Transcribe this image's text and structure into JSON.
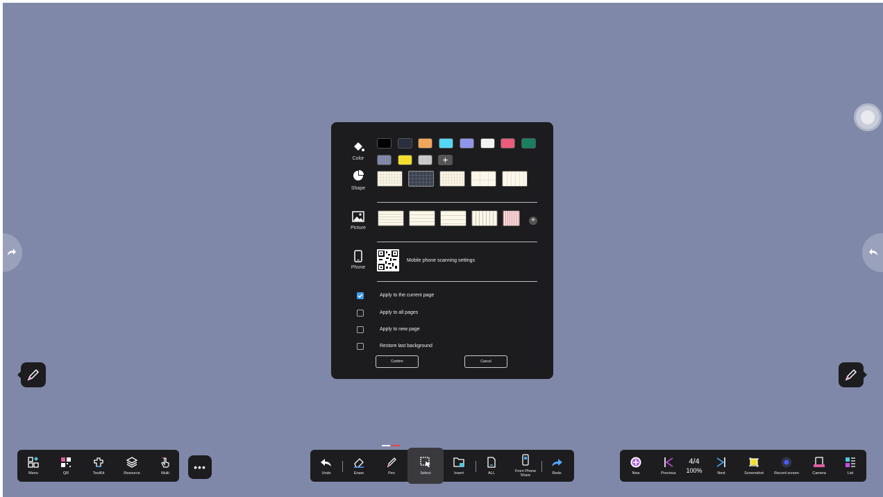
{
  "dialog": {
    "sections": {
      "color": "Color",
      "shape": "Shape",
      "picture": "Picture",
      "phone": "Phone"
    },
    "colors": [
      "#000000",
      "#2a2f3f",
      "#f2a65a",
      "#55d6f5",
      "#8f96e8",
      "#f3f3f3",
      "#ea5c7a",
      "#18805e",
      "#7f88a8",
      "#f5de2b",
      "#c8c8c8"
    ],
    "add_color_icon": "plus-icon",
    "phone_text": "Mobile phone scanning settings",
    "options": [
      {
        "label": "Apply to the current page",
        "checked": true
      },
      {
        "label": "Apply to all pages",
        "checked": false
      },
      {
        "label": "Apply to new page",
        "checked": false
      },
      {
        "label": "Restore last background",
        "checked": false
      }
    ],
    "confirm": "Confirm",
    "cancel": "Cancel"
  },
  "left_toolbar": [
    {
      "label": "Menu",
      "icon": "menu-icon"
    },
    {
      "label": "QR",
      "icon": "qr-icon"
    },
    {
      "label": "ToolKit",
      "icon": "toolkit-icon"
    },
    {
      "label": "Resource",
      "icon": "layers-icon"
    },
    {
      "label": "Multi",
      "icon": "hand-icon"
    }
  ],
  "more_button_icon": "more-icon",
  "center_toolbar": [
    {
      "label": "Undo",
      "icon": "undo-icon"
    },
    {
      "label": "Erase",
      "icon": "eraser-icon"
    },
    {
      "label": "Pen",
      "icon": "pen-icon"
    },
    {
      "label": "Select",
      "icon": "select-icon",
      "active": true
    },
    {
      "label": "Insert",
      "icon": "insert-icon"
    },
    {
      "label": "ALL",
      "icon": "document-icon"
    },
    {
      "label": "From Phone Share",
      "icon": "phone-share-icon"
    },
    {
      "label": "Redo",
      "icon": "redo-icon"
    }
  ],
  "right_toolbar": {
    "new_label": "New",
    "previous_label": "Previous",
    "page": "4/4",
    "zoom": "100%",
    "next_label": "Next",
    "screenshot_label": "Screenshot",
    "record_label": "Record screen",
    "camera_label": "Camera",
    "list_label": "List"
  },
  "colors_theme": {
    "background": "#7f88a8",
    "toolbar": "#1d1d1f",
    "accent": "#3d9be9"
  }
}
